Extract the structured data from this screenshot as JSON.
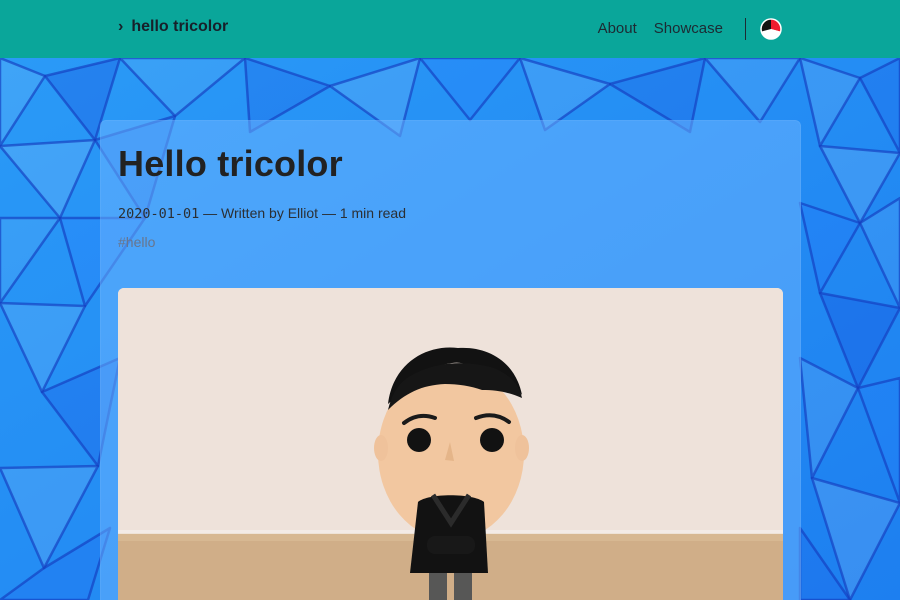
{
  "header": {
    "brand": "hello tricolor",
    "nav": [
      {
        "label": "About"
      },
      {
        "label": "Showcase"
      }
    ]
  },
  "post": {
    "title": "Hello tricolor",
    "date": "2020-01-01",
    "meta_rest": " — Written by Elliot — 1 min read",
    "tag": "#hello"
  },
  "colors": {
    "header_bg": "#0aa69a",
    "card_bg": "#6eb4ff",
    "page_bg": "#2a92f2"
  },
  "icons": {
    "brand": "chevron-right-icon",
    "theme": "tricolor-icon"
  }
}
